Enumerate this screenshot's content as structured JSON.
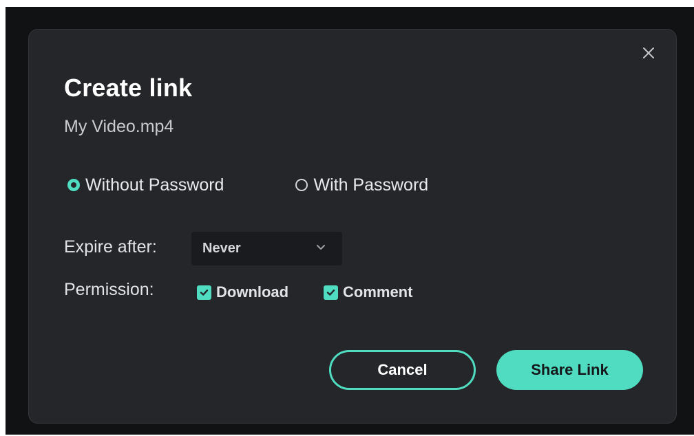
{
  "dialog": {
    "title": "Create link",
    "filename": "My Video.mp4",
    "close_icon": "close-icon"
  },
  "password_options": [
    {
      "label": "Without Password",
      "selected": true
    },
    {
      "label": "With Password",
      "selected": false
    }
  ],
  "expire": {
    "label": "Expire after:",
    "value": "Never",
    "icon": "chevron-down-icon"
  },
  "permission": {
    "label": "Permission:",
    "options": [
      {
        "label": "Download",
        "checked": true
      },
      {
        "label": "Comment",
        "checked": true
      }
    ]
  },
  "buttons": {
    "cancel": "Cancel",
    "share": "Share Link"
  },
  "colors": {
    "accent": "#4fdcc0",
    "dialog_bg": "#24262a",
    "backdrop": "#111214"
  }
}
